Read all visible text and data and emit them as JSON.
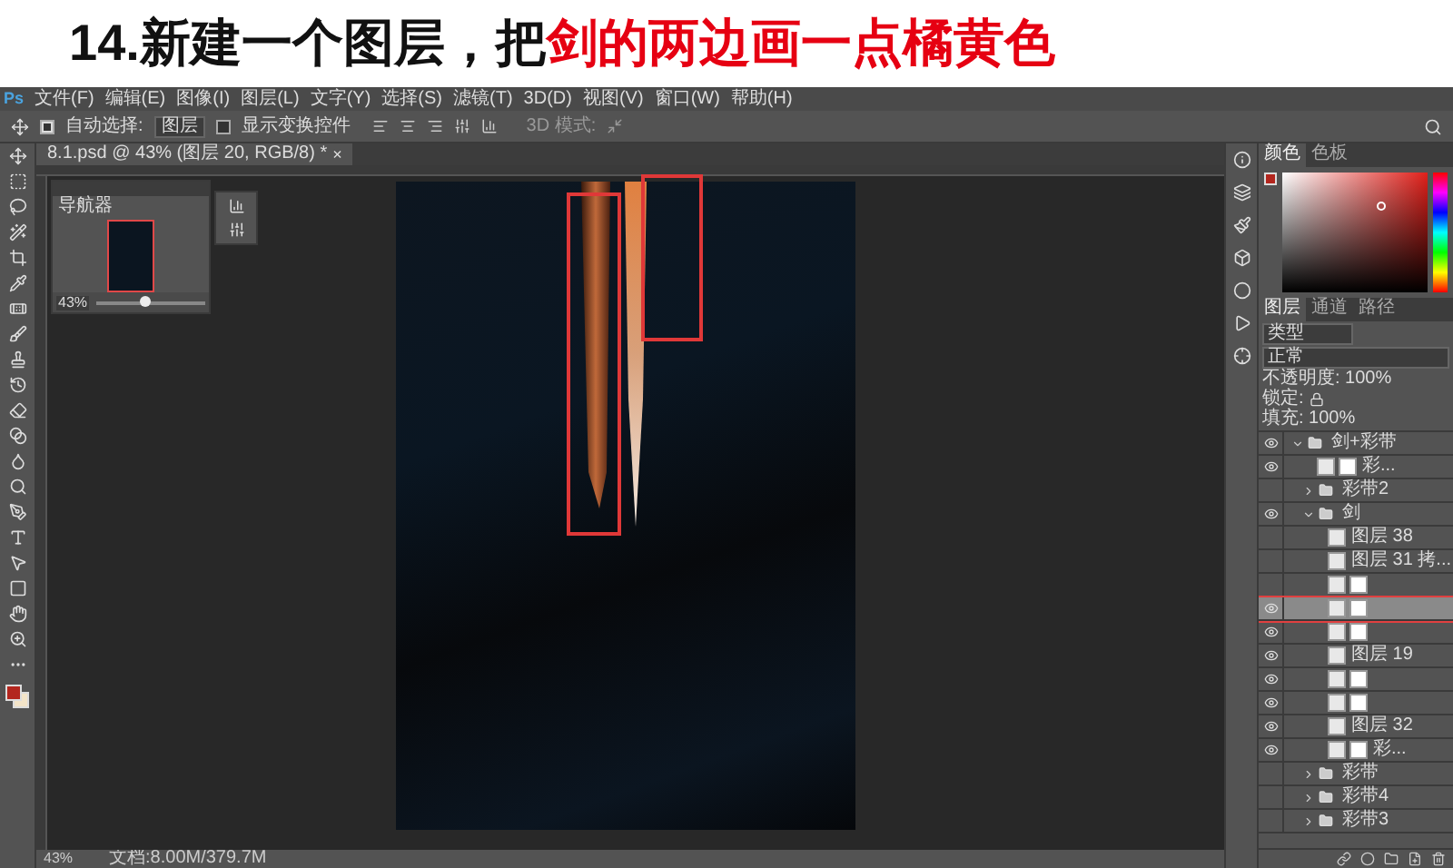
{
  "heading": {
    "text": "14.新建一个图层，把",
    "highlight": "剑的两边画一点橘黄色"
  },
  "app_logo": "Ps",
  "menu": [
    "文件(F)",
    "编辑(E)",
    "图像(I)",
    "图层(L)",
    "文字(Y)",
    "选择(S)",
    "滤镜(T)",
    "3D(D)",
    "视图(V)",
    "窗口(W)",
    "帮助(H)"
  ],
  "options_bar": {
    "auto_select": {
      "label": "自动选择:",
      "checked": true
    },
    "target": "图层",
    "show_transform": {
      "label": "显示变换控件",
      "checked": false
    },
    "mode_3d": "3D 模式:"
  },
  "document_tab": {
    "title": "8.1.psd @ 43% (图层 20, RGB/8) *",
    "close": "×"
  },
  "navigator": {
    "tab": "导航器",
    "zoom": "43%",
    "level": 0.45
  },
  "color_panel": {
    "tabs": [
      {
        "label": "颜色",
        "selected": true
      },
      {
        "label": "色板",
        "selected": false
      }
    ]
  },
  "layers_panel": {
    "tabs": [
      {
        "label": "图层",
        "selected": true
      },
      {
        "label": "通道",
        "selected": false
      },
      {
        "label": "路径",
        "selected": false
      }
    ],
    "filter": "类型",
    "blend_mode": "正常",
    "opacity": "不透明度: 100%",
    "lock": "锁定:",
    "fill": "填充: 100%",
    "layers": [
      {
        "kind": "group",
        "name": "剑+彩带",
        "visible": true,
        "selected": false,
        "expanded": true,
        "children": [
          {
            "kind": "layer",
            "name": "彩...",
            "visible": true,
            "selected": false,
            "mask": true
          },
          {
            "kind": "group",
            "name": "彩带2",
            "visible": false,
            "selected": false,
            "expanded": false
          },
          {
            "kind": "group",
            "name": "剑",
            "visible": true,
            "selected": false,
            "expanded": true,
            "children": [
              {
                "kind": "layer",
                "name": "图层 38",
                "visible": false,
                "selected": false,
                "mask": false
              },
              {
                "kind": "layer",
                "name": "图层 31 拷...",
                "visible": false,
                "selected": false,
                "mask": false
              },
              {
                "kind": "layer",
                "visible": false,
                "selected": false,
                "mask": true
              },
              {
                "kind": "layer",
                "visible": true,
                "selected": true,
                "mask": true
              },
              {
                "kind": "layer",
                "visible": true,
                "selected": false,
                "mask": true
              },
              {
                "kind": "layer",
                "name": "图层 19",
                "visible": true,
                "selected": false,
                "mask": false
              },
              {
                "kind": "layer",
                "visible": true,
                "selected": false,
                "mask": true
              },
              {
                "kind": "layer",
                "visible": true,
                "selected": false,
                "mask": true
              },
              {
                "kind": "layer",
                "name": "图层 32",
                "visible": true,
                "selected": false,
                "mask": false
              },
              {
                "kind": "layer",
                "name": "彩...",
                "visible": true,
                "selected": false,
                "mask": true
              }
            ]
          },
          {
            "kind": "group",
            "name": "彩带",
            "visible": false,
            "selected": false,
            "expanded": false
          },
          {
            "kind": "group",
            "name": "彩带4",
            "visible": false,
            "selected": false,
            "expanded": false
          },
          {
            "kind": "group",
            "name": "彩带3",
            "visible": false,
            "selected": false,
            "expanded": false
          }
        ]
      }
    ]
  },
  "status_bar": {
    "zoom": "43%",
    "doc_size": "文档:8.00M/379.7M"
  }
}
